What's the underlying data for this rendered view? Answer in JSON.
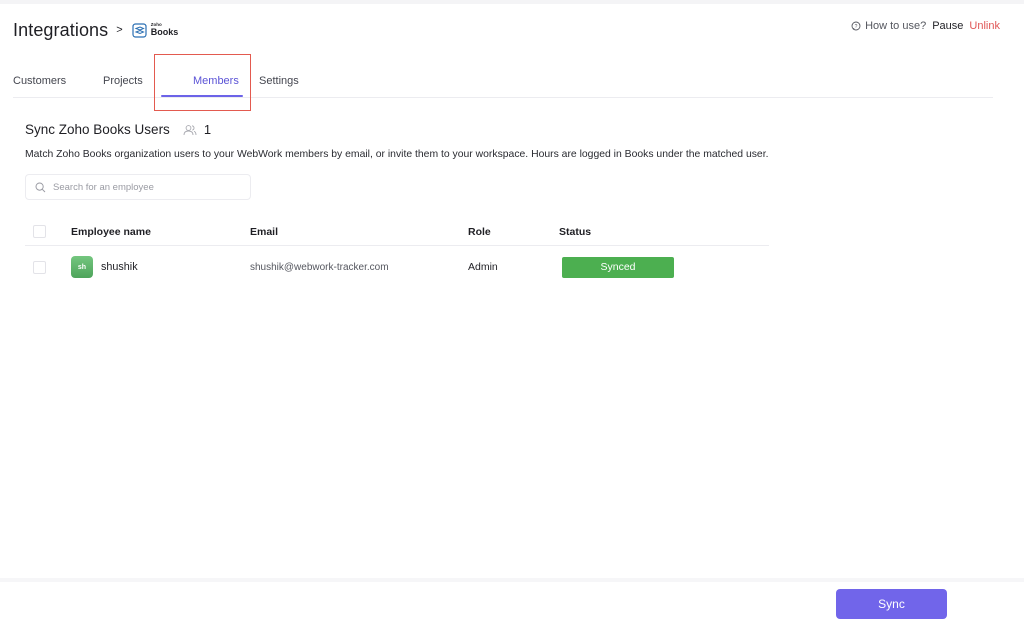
{
  "header": {
    "title": "Integrations",
    "breadcrumb_separator": ">",
    "logo": {
      "small_text": "Zoho",
      "main_text": "Books"
    },
    "actions": {
      "how_to_use": "How to use?",
      "pause": "Pause",
      "unlink": "Unlink"
    }
  },
  "tabs": [
    {
      "label": "Customers",
      "active": false
    },
    {
      "label": "Projects",
      "active": false
    },
    {
      "label": "Members",
      "active": true
    },
    {
      "label": "Settings",
      "active": false
    }
  ],
  "section": {
    "title": "Sync Zoho Books Users",
    "member_count": "1",
    "description": "Match Zoho Books organization users to your WebWork members by email, or invite them to your workspace. Hours are logged in Books under the matched user."
  },
  "search": {
    "placeholder": "Search for an employee",
    "value": ""
  },
  "table": {
    "columns": [
      "Employee name",
      "Email",
      "Role",
      "Status"
    ],
    "rows": [
      {
        "initials": "sh",
        "name": "shushik",
        "email": "shushik@webwork-tracker.com",
        "role": "Admin",
        "status": "Synced"
      }
    ]
  },
  "footer": {
    "sync_label": "Sync"
  },
  "colors": {
    "accent": "#7165ea",
    "active_tab": "#5b53d6",
    "unlink": "#e05656",
    "synced": "#4caf50",
    "highlight": "#e35a4f"
  },
  "icons": {
    "how_to_use": "chat-bubble-icon",
    "member_count": "users-icon",
    "search": "search-icon",
    "logo": "zoho-books-logo-icon"
  }
}
